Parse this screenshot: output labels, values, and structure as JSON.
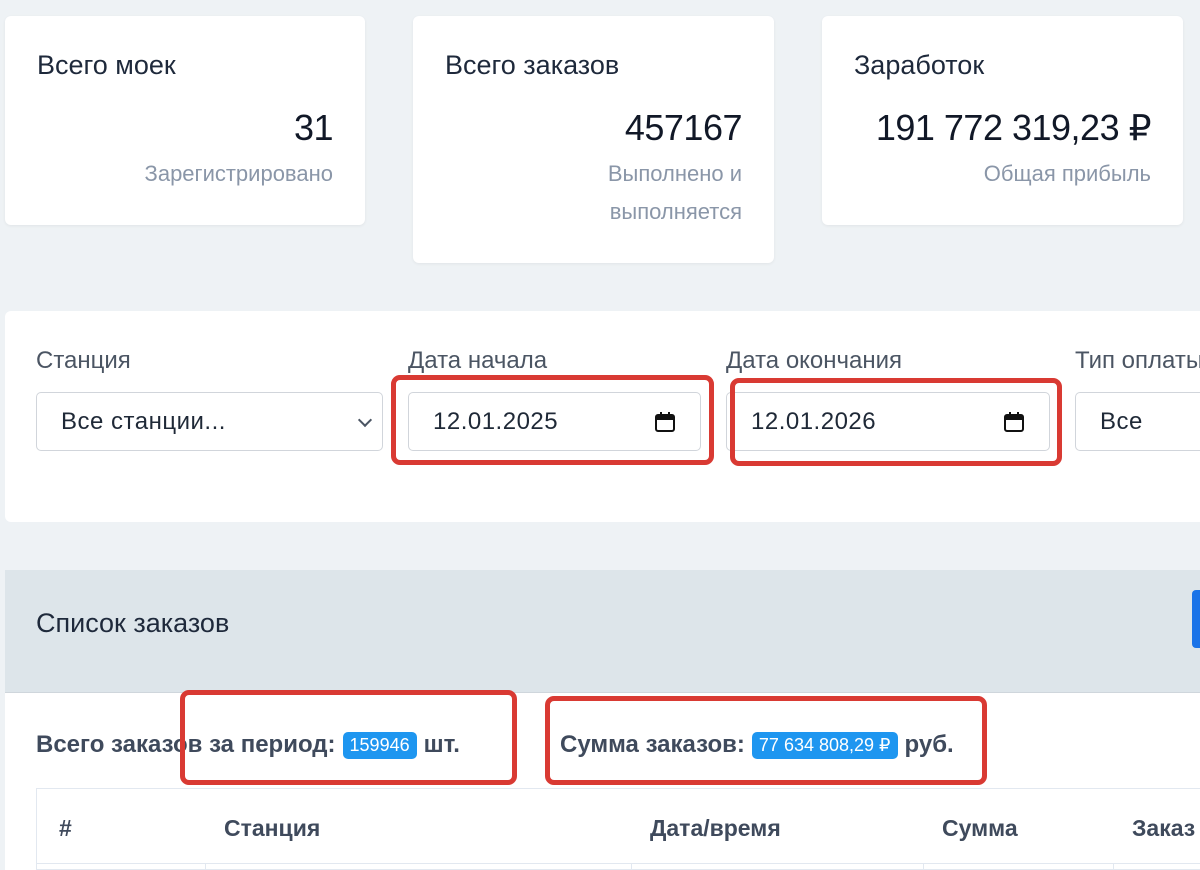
{
  "stats": {
    "washes": {
      "title": "Всего моек",
      "value": "31",
      "caption": "Зарегистрировано"
    },
    "orders": {
      "title": "Всего заказов",
      "value": "457167",
      "caption_line1": "Выполнено и",
      "caption_line2": "выполняется"
    },
    "income": {
      "title": "Заработок",
      "value": "191 772 319,23 ₽",
      "caption": "Общая прибыль"
    }
  },
  "filters": {
    "station": {
      "label": "Станция",
      "value": "Все станции..."
    },
    "start_date": {
      "label": "Дата начала",
      "value": "12.01.2025"
    },
    "end_date": {
      "label": "Дата окончания",
      "value": "12.01.2026"
    },
    "payment_type": {
      "label": "Тип оплаты",
      "value": "Все"
    }
  },
  "orders": {
    "title": "Список заказов",
    "total_label": "Всего заказов за период:",
    "total_count": "159946",
    "total_unit": "шт.",
    "sum_label": "Сумма заказов:",
    "sum_value": "77 634 808,29 ₽",
    "sum_unit": "руб.",
    "columns": [
      "#",
      "Станция",
      "Дата/время",
      "Сумма",
      "Заказ"
    ]
  },
  "colors": {
    "accent": "#1e96f0",
    "highlight": "#d93a33",
    "button": "#1a73e8"
  }
}
